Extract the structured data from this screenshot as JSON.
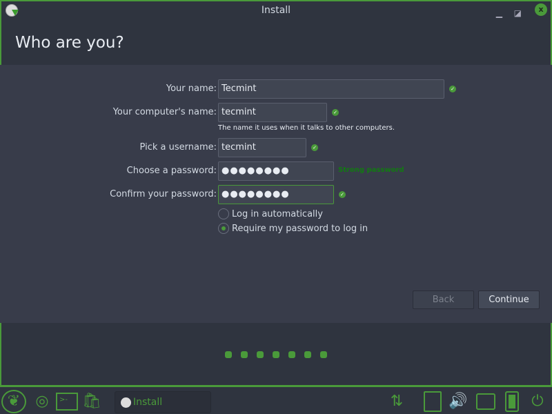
{
  "window": {
    "title": "Install",
    "minimize": "▁",
    "maximize": "◪",
    "close": "x"
  },
  "page": {
    "title": "Who are you?"
  },
  "form": {
    "name_label": "Your name:",
    "name_value": "Tecmint",
    "computer_label": "Your computer's name:",
    "computer_value": "tecmint",
    "computer_hint": "The name it uses when it talks to other computers.",
    "username_label": "Pick a username:",
    "username_value": "tecmint",
    "password_label": "Choose a password:",
    "password_value": "●●●●●●●●",
    "password_strength": "Strong password",
    "confirm_label": "Confirm your password:",
    "confirm_value": "●●●●●●●●",
    "login_auto": "Log in automatically",
    "login_require": "Require my password to log in",
    "selected_login": "require"
  },
  "buttons": {
    "back": "Back",
    "continue": "Continue"
  },
  "progress": {
    "steps": 7
  },
  "taskbar": {
    "task_label": "Install"
  },
  "colors": {
    "accent": "#4a9a3a",
    "strong": "#127a12"
  }
}
